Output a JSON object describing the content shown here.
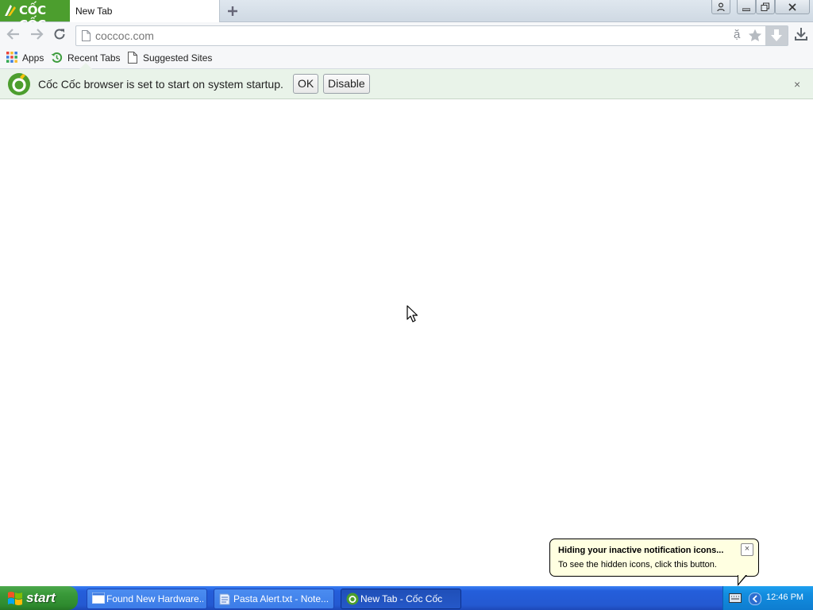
{
  "browser": {
    "brand": "CỐC CỐC",
    "tab": {
      "title": "New Tab"
    },
    "omnibox": {
      "url": "coccoc.com",
      "translate_glyph": "ặ"
    },
    "bookmarks": [
      {
        "label": "Apps",
        "icon": "apps-grid-icon"
      },
      {
        "label": "Recent Tabs",
        "icon": "history-icon"
      },
      {
        "label": "Suggested Sites",
        "icon": "page-icon"
      }
    ],
    "infobar": {
      "message": "Cốc Cốc browser is set to start on system startup.",
      "ok_label": "OK",
      "disable_label": "Disable",
      "close_glyph": "×"
    },
    "colors": {
      "brand_green": "#4c9e2e",
      "infobar_bg": "#e9f3e9"
    }
  },
  "balloon": {
    "title": "Hiding your inactive notification icons...",
    "text": "To see the hidden icons, click this button.",
    "close_glyph": "×"
  },
  "taskbar": {
    "start_label": "start",
    "tasks": [
      {
        "label": "Found New Hardware...",
        "icon": "hardware-window-icon",
        "active": false
      },
      {
        "label": "Pasta Alert.txt - Note...",
        "icon": "notepad-icon",
        "active": false
      },
      {
        "label": "New Tab - Cốc Cốc",
        "icon": "coccoc-icon",
        "active": true
      }
    ],
    "clock": "12:46 PM"
  }
}
